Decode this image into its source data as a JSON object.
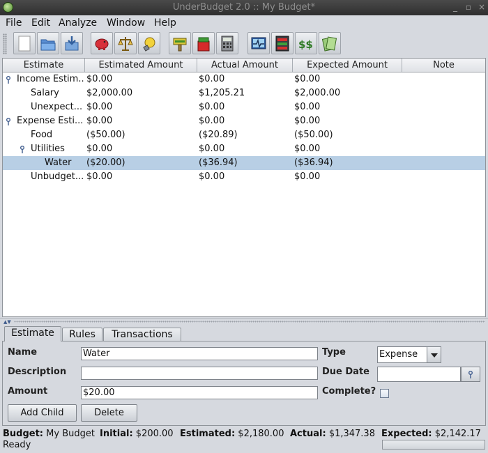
{
  "window": {
    "title": "UnderBudget 2.0 :: My Budget*",
    "buttons": [
      "_",
      "▫",
      "×"
    ]
  },
  "menu": [
    "File",
    "Edit",
    "Analyze",
    "Window",
    "Help"
  ],
  "toolbar": {
    "buttons": [
      "new-document",
      "open-folder",
      "save",
      "piggy-bank",
      "balance-scale",
      "lightbulb",
      "sign",
      "shopping-bag",
      "calculator",
      "pulse-monitor",
      "meter-bars",
      "dollar-signs",
      "money-stack"
    ]
  },
  "table": {
    "columns": [
      "Estimate",
      "Estimated Amount",
      "Actual Amount",
      "Expected Amount",
      "Note"
    ],
    "rows": [
      {
        "name": "Income Estim...",
        "estimated": "$0.00",
        "actual": "$0.00",
        "expected": "$0.00",
        "note": ""
      },
      {
        "name": "Salary",
        "estimated": "$2,000.00",
        "actual": "$1,205.21",
        "expected": "$2,000.00",
        "note": ""
      },
      {
        "name": "Unexpect...",
        "estimated": "$0.00",
        "actual": "$0.00",
        "expected": "$0.00",
        "note": ""
      },
      {
        "name": "Expense Esti...",
        "estimated": "$0.00",
        "actual": "$0.00",
        "expected": "$0.00",
        "note": ""
      },
      {
        "name": "Food",
        "estimated": "($50.00)",
        "actual": "($20.89)",
        "expected": "($50.00)",
        "note": ""
      },
      {
        "name": "Utilities",
        "estimated": "$0.00",
        "actual": "$0.00",
        "expected": "$0.00",
        "note": ""
      },
      {
        "name": "Water",
        "estimated": "($20.00)",
        "actual": "($36.94)",
        "expected": "($36.94)",
        "note": ""
      },
      {
        "name": "Unbudget...",
        "estimated": "$0.00",
        "actual": "$0.00",
        "expected": "$0.00",
        "note": ""
      }
    ],
    "selected_row": "Water"
  },
  "tabs": [
    "Estimate",
    "Rules",
    "Transactions"
  ],
  "active_tab": "Estimate",
  "form": {
    "name_label": "Name",
    "name_value": "Water",
    "description_label": "Description",
    "description_value": "",
    "amount_label": "Amount",
    "amount_value": "$20.00",
    "type_label": "Type",
    "type_value": "Expense",
    "due_date_label": "Due Date",
    "due_date_value": "",
    "complete_label": "Complete?",
    "complete_checked": false,
    "add_child_label": "Add Child",
    "delete_label": "Delete"
  },
  "status": {
    "budget_label": "Budget:",
    "budget_value": "My Budget",
    "initial_label": "Initial:",
    "initial_value": "$200.00",
    "estimated_label": "Estimated:",
    "estimated_value": "$2,180.00",
    "actual_label": "Actual:",
    "actual_value": "$1,347.38",
    "expected_label": "Expected:",
    "expected_value": "$2,142.17",
    "state": "Ready"
  }
}
